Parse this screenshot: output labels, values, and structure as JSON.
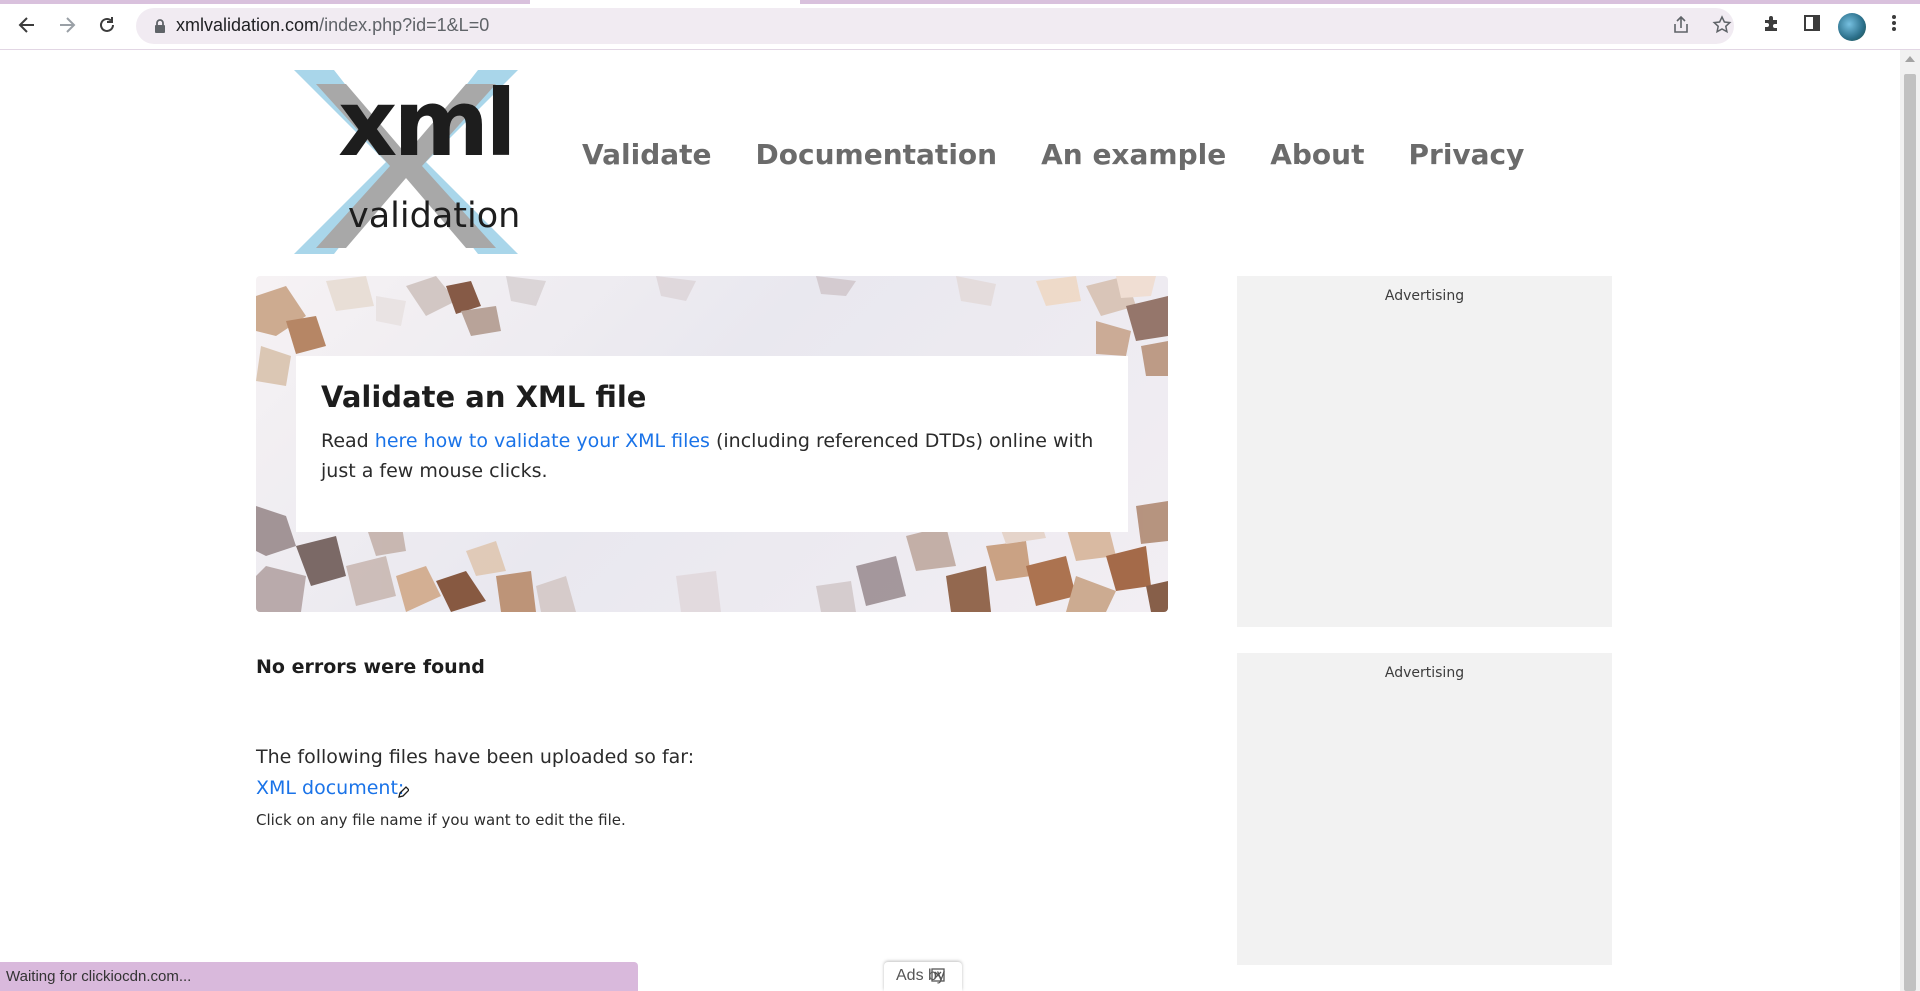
{
  "browser": {
    "url_host": "xmlvalidation.com",
    "url_path": "/index.php?id=1&L=0",
    "status_text": "Waiting for clickiocdn.com...",
    "ads_by_text": "Ads by"
  },
  "site": {
    "logo_main": "xml",
    "logo_sub": "validation",
    "nav": [
      "Validate",
      "Documentation",
      "An example",
      "About",
      "Privacy"
    ]
  },
  "hero": {
    "title": "Validate an XML file",
    "text_before": "Read ",
    "link_text": "here how to validate your XML files",
    "text_after": " (including referenced DTDs) online with just a few mouse clicks."
  },
  "ads": {
    "label_1": "Advertising",
    "label_2": "Advertising"
  },
  "result": {
    "message": "No errors were found",
    "uploaded_heading": "The following files have been uploaded so far:",
    "file_link": "XML document:",
    "hint": "Click on any file name if you want to edit the file."
  },
  "icons": {
    "back": "back-arrow-icon",
    "forward": "forward-arrow-icon",
    "reload": "reload-icon",
    "share": "share-icon",
    "bookmark": "star-icon",
    "extensions": "puzzle-icon",
    "sidepanel": "side-panel-icon",
    "menu": "kebab-menu-icon"
  },
  "colors": {
    "link": "#1a73e8",
    "nav_text": "#6b6b6b",
    "logo_x_blue": "#a9d6ea",
    "logo_x_grey": "#a8a8a8",
    "ad_background": "#f2f2f2",
    "status_bar": "#d9b9dc"
  }
}
